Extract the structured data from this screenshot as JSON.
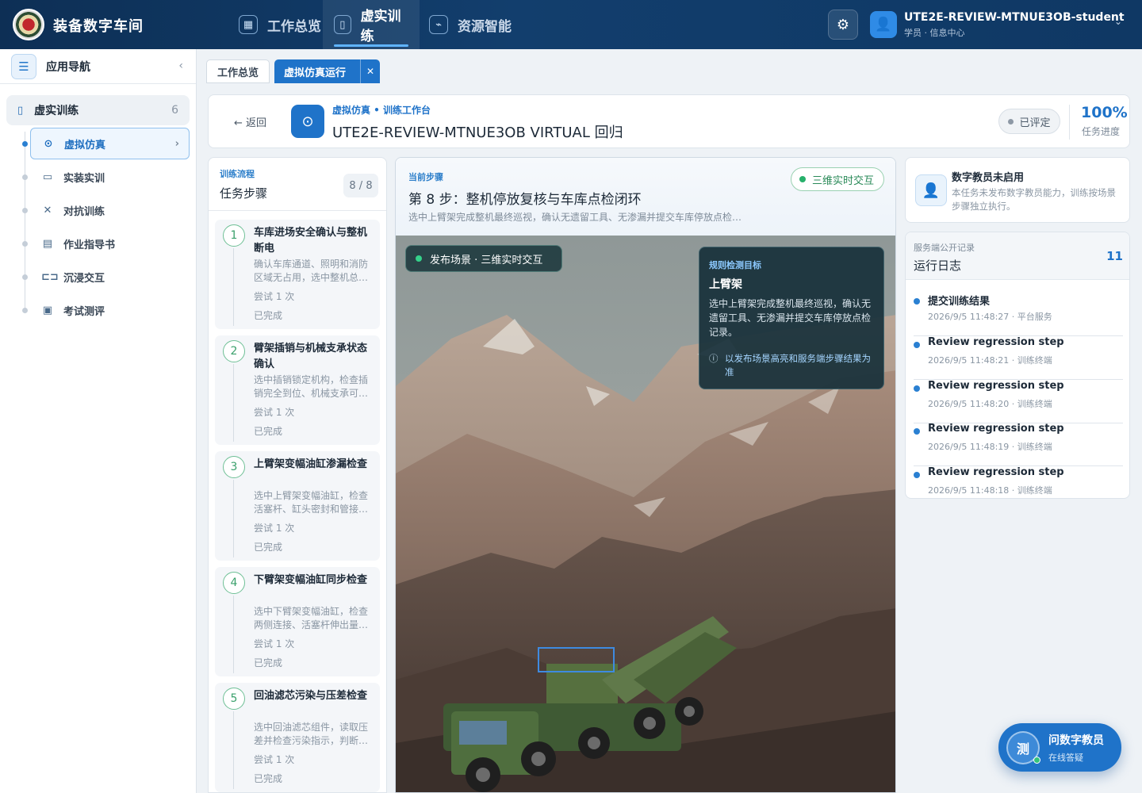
{
  "app": {
    "title": "装备数字车间"
  },
  "topnav": [
    {
      "label": "工作总览",
      "icon": "grid-icon"
    },
    {
      "label": "虚实训练",
      "icon": "book-icon"
    },
    {
      "label": "资源智能",
      "icon": "plug-icon"
    }
  ],
  "user": {
    "name": "UTE2E-REVIEW-MTNUE3OB-student",
    "role": "学员 · 信息中心"
  },
  "sidebar": {
    "title": "应用导航",
    "group": {
      "label": "虚实训练",
      "count": "6"
    },
    "items": [
      {
        "label": "虚拟仿真",
        "icon": "play-circle-icon"
      },
      {
        "label": "实装实训",
        "icon": "monitor-icon"
      },
      {
        "label": "对抗训练",
        "icon": "swords-icon"
      },
      {
        "label": "作业指导书",
        "icon": "document-icon"
      },
      {
        "label": "沉浸交互",
        "icon": "vr-headset-icon"
      },
      {
        "label": "考试测评",
        "icon": "clipboard-icon"
      }
    ]
  },
  "tabs": [
    {
      "label": "工作总览"
    },
    {
      "label": "虚拟仿真运行"
    }
  ],
  "header": {
    "back_label": "返回",
    "breadcrumb": "虚拟仿真 • 训练工作台",
    "title": "UTE2E-REVIEW-MTNUE3OB VIRTUAL 回归",
    "status": "已评定",
    "progress": "100%",
    "progress_label": "任务进度"
  },
  "steps_panel": {
    "subtitle": "训练流程",
    "title": "任务步骤",
    "count": "8 / 8",
    "steps": [
      {
        "num": "1",
        "name": "车库进场安全确认与整机断电",
        "desc": "确认车库通道、照明和消防区域无占用，选中整机总…",
        "tries": "尝试 1 次",
        "status": "已完成"
      },
      {
        "num": "2",
        "name": "臂架插销与机械支承状态确认",
        "desc": "选中插销锁定机构，检查插销完全到位、机械支承可…",
        "tries": "尝试 1 次",
        "status": "已完成"
      },
      {
        "num": "3",
        "name": "上臂架变幅油缸渗漏检查",
        "desc": "选中上臂架变幅油缸，检查活塞杆、缸头密封和管接…",
        "tries": "尝试 1 次",
        "status": "已完成"
      },
      {
        "num": "4",
        "name": "下臂架变幅油缸同步检查",
        "desc": "选中下臂架变幅油缸，检查两侧连接、活塞杆伸出量…",
        "tries": "尝试 1 次",
        "status": "已完成"
      },
      {
        "num": "5",
        "name": "回油滤芯污染与压差检查",
        "desc": "选中回油滤芯组件，读取压差并检查污染指示，判断…",
        "tries": "尝试 1 次",
        "status": "已完成"
      }
    ]
  },
  "current_step": {
    "subtitle": "当前步骤",
    "title": "第 8 步：整机停放复核与车库点检闭环",
    "desc": "选中上臂架完成整机最终巡视，确认无遗留工具、无渗漏并提交车库停放点检…",
    "mode": "三维实时交互"
  },
  "scene": {
    "label": "发布场景 · 三维实时交互",
    "target": {
      "subtitle": "规则检测目标",
      "name": "上臂架",
      "desc": "选中上臂架完成整机最终巡视，确认无遗留工具、无渗漏并提交车库停放点检记录。",
      "note": "以发布场景高亮和服务端步骤结果为准"
    }
  },
  "teacher": {
    "title": "数字教员未启用",
    "desc": "本任务未发布数字教员能力，训练按场景步骤独立执行。"
  },
  "log": {
    "subtitle": "服务端公开记录",
    "title": "运行日志",
    "count": "11",
    "entries": [
      {
        "msg": "提交训练结果",
        "meta": "2026/9/5 11:48:27 · 平台服务"
      },
      {
        "msg": "Review regression step",
        "meta": "2026/9/5 11:48:21 · 训练终端"
      },
      {
        "msg": "Review regression step",
        "meta": "2026/9/5 11:48:20 · 训练终端"
      },
      {
        "msg": "Review regression step",
        "meta": "2026/9/5 11:48:19 · 训练终端"
      },
      {
        "msg": "Review regression step",
        "meta": "2026/9/5 11:48:18 · 训练终端"
      }
    ]
  },
  "assistant": {
    "avatar": "测",
    "title": "问数字教员",
    "status": "在线答疑"
  },
  "colors": {
    "primary": "#1f73c9",
    "topbar": "#123e6d",
    "success": "#27b06b"
  }
}
